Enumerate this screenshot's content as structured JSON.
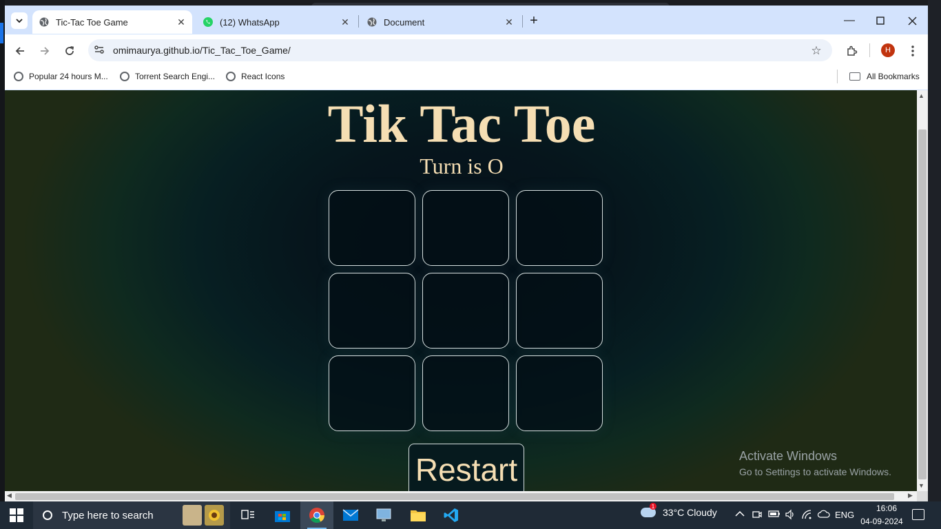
{
  "browser": {
    "tabs": [
      {
        "title": "Tic-Tac Toe Game",
        "active": true,
        "icon": "globe-icon"
      },
      {
        "title": "(12) WhatsApp",
        "active": false,
        "icon": "whatsapp-icon"
      },
      {
        "title": "Document",
        "active": false,
        "icon": "globe-icon"
      }
    ],
    "url": "omimaurya.github.io/Tic_Tac_Toe_Game/",
    "profile_initial": "H",
    "bookmarks": [
      {
        "label": "Popular 24 hours M..."
      },
      {
        "label": "Torrent Search Engi..."
      },
      {
        "label": "React Icons"
      }
    ],
    "all_bookmarks_label": "All Bookmarks"
  },
  "game": {
    "title": "Tik Tac Toe",
    "turn_text": "Turn is O",
    "board": [
      "",
      "",
      "",
      "",
      "",
      "",
      "",
      "",
      ""
    ],
    "restart_label": "Restart"
  },
  "watermark": {
    "line1": "Activate Windows",
    "line2": "Go to Settings to activate Windows."
  },
  "taskbar": {
    "search_placeholder": "Type here to search",
    "weather": "33°C  Cloudy",
    "weather_badge": "1",
    "language": "ENG",
    "time": "16:06",
    "date": "04-09-2024"
  },
  "colors": {
    "title_color": "#f5deb3",
    "cell_border": "#d7e0e0",
    "chrome_frame": "#d3e3fd",
    "taskbar_bg": "#1f2a36"
  }
}
